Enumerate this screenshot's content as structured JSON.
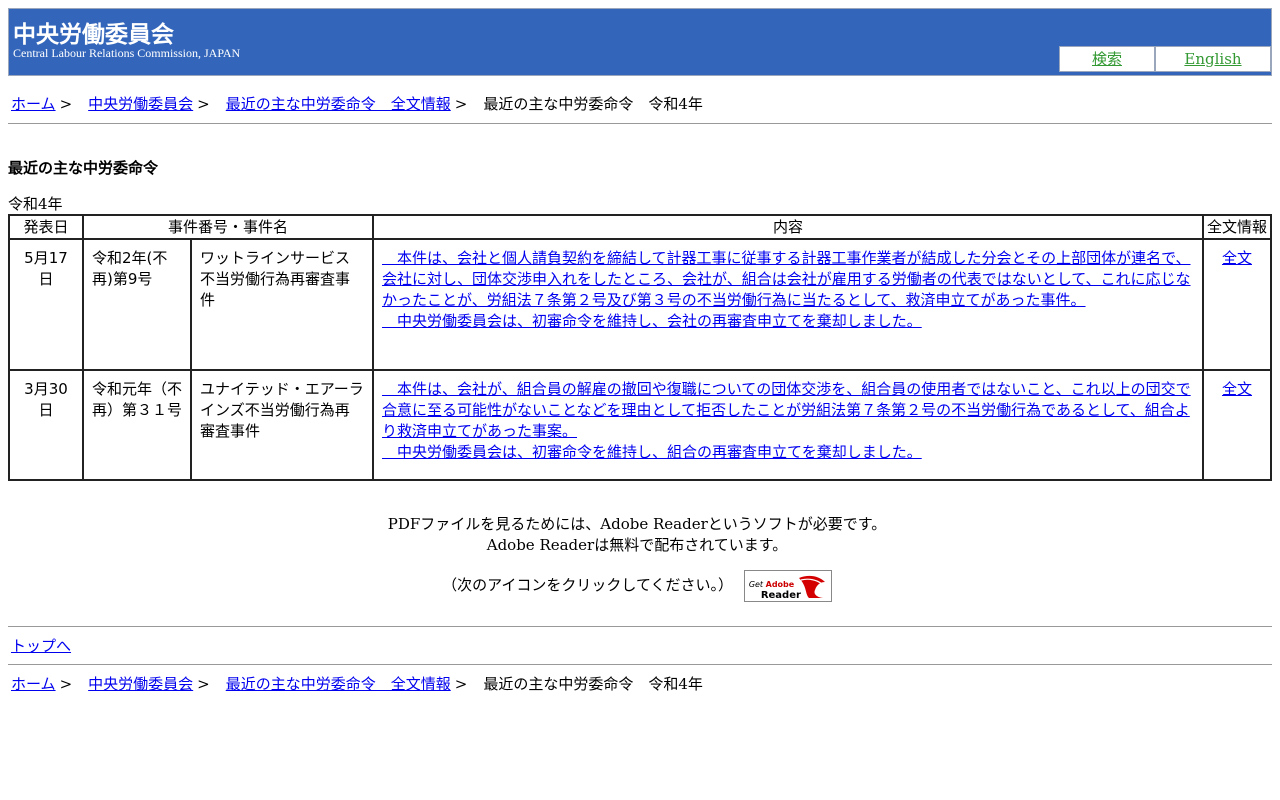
{
  "header": {
    "title": "中央労働委員会",
    "subtitle": "Central Labour Relations Commission, JAPAN",
    "search_label": "検索",
    "english_label": "English"
  },
  "breadcrumb": {
    "home": "ホーム",
    "commission": "中央労働委員会",
    "orders_list": "最近の主な中労委命令　全文情報",
    "current": "最近の主な中労委命令　令和4年",
    "separator": ">"
  },
  "page": {
    "heading": "最近の主な中労委命令",
    "year": "令和4年"
  },
  "table": {
    "headers": {
      "date": "発表日",
      "case": "事件番号・事件名",
      "content": "内容",
      "fulltext": "全文情報"
    },
    "rows": [
      {
        "date": "5月17日",
        "case_number": "令和2年(不再)第9号",
        "case_name": "ワットラインサービス不当労働行為再審査事件",
        "summary": "　本件は、会社と個人請負契約を締結して計器工事に従事する計器工事作業者が結成した分会とその上部団体が連名で、会社に対し、団体交渉申入れをしたところ、会社が、組合は会社が雇用する労働者の代表ではないとして、これに応じなかったことが、労組法７条第２号及び第３号の不当労働行為に当たるとして、救済申立てがあった事件。",
        "result": "　中央労働委員会は、初審命令を維持し、会社の再審査申立てを棄却しました。",
        "fulltext_label": "全文"
      },
      {
        "date": "3月30日",
        "case_number": "令和元年（不再）第３１号",
        "case_name": "ユナイテッド・エアーラインズ不当労働行為再審査事件",
        "summary": "　本件は、会社が、組合員の解雇の撤回や復職についての団体交渉を、組合員の使用者ではないこと、これ以上の団交で合意に至る可能性がないことなどを理由として拒否したことが労組法第７条第２号の不当労働行為であるとして、組合より救済申立てがあった事案。",
        "result": "　中央労働委員会は、初審命令を維持し、組合の再審査申立てを棄却しました。",
        "fulltext_label": "全文"
      }
    ]
  },
  "pdf_note": {
    "line1": "PDFファイルを見るためには、Adobe Readerというソフトが必要です。",
    "line2": "Adobe Readerは無料で配布されています。",
    "line3": "（次のアイコンをクリックしてください。）",
    "badge_get": "Get",
    "badge_adobe": "Adobe",
    "badge_reader": "Reader"
  },
  "footer": {
    "to_top": "トップへ"
  }
}
